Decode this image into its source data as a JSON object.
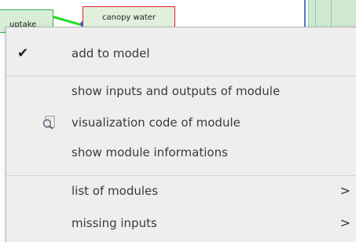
{
  "diagram": {
    "nodes": [
      {
        "label": "uptake"
      },
      {
        "label": "canopy water"
      }
    ]
  },
  "context_menu": {
    "items": [
      {
        "label": "add to model",
        "checked": true,
        "icon": "check-icon"
      },
      {
        "label": "show inputs and outputs of module"
      },
      {
        "label": "visualization code of module",
        "icon": "magnifier-document-icon"
      },
      {
        "label": "show module informations"
      },
      {
        "label": "list of modules",
        "submenu": true
      },
      {
        "label": "missing inputs",
        "submenu": true
      }
    ]
  }
}
